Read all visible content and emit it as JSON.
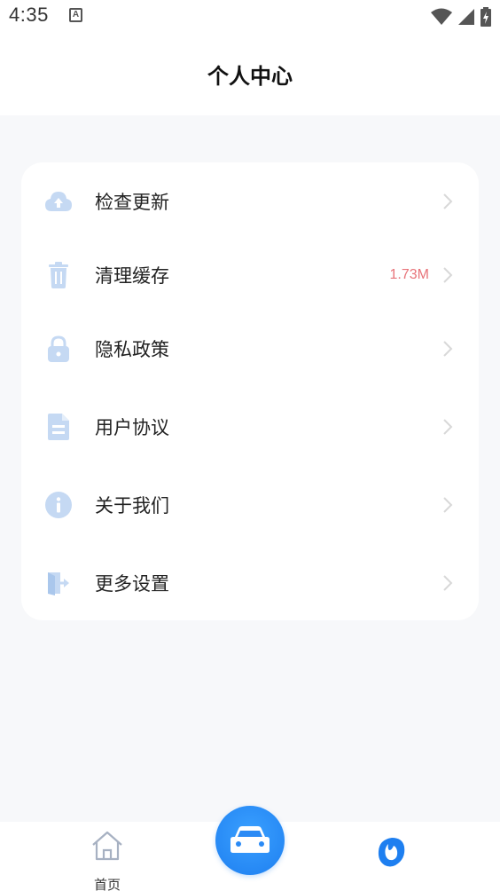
{
  "status_bar": {
    "time": "4:35",
    "app_icon_letter": "A"
  },
  "header": {
    "title": "个人中心"
  },
  "menu": {
    "items": [
      {
        "label": "检查更新",
        "icon": "cloud-upload-icon",
        "value": ""
      },
      {
        "label": "清理缓存",
        "icon": "trash-icon",
        "value": "1.73M"
      },
      {
        "label": "隐私政策",
        "icon": "lock-icon",
        "value": ""
      },
      {
        "label": "用户协议",
        "icon": "document-icon",
        "value": ""
      },
      {
        "label": "关于我们",
        "icon": "info-icon",
        "value": ""
      },
      {
        "label": "更多设置",
        "icon": "exit-door-icon",
        "value": ""
      }
    ]
  },
  "bottom_nav": {
    "home_label": "首页",
    "center_icon": "car-icon",
    "profile_icon": "profile-icon"
  },
  "colors": {
    "accent": "#1e7ff0",
    "icon_tint": "#c5d9f3",
    "cache_value": "#e8747a",
    "background": "#f7f8fa"
  }
}
